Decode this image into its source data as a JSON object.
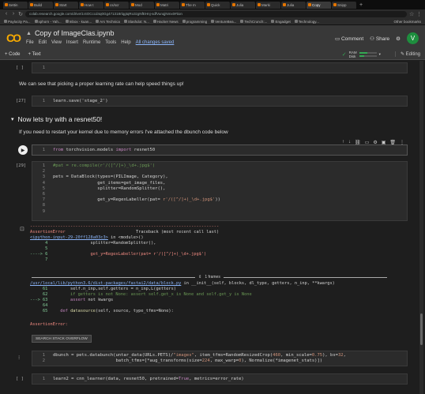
{
  "browser": {
    "tabs": [
      "Settin",
      "Build",
      "Start",
      "How t",
      "cs/scr",
      "Mod",
      "Matri",
      "The m",
      "Quick",
      "Julia",
      "Marki",
      "Julia",
      "Copy",
      "Snipp"
    ],
    "url": "colab.research.google.com/drive/1r4OCccd4q0Gg471318rlqgtqRo3zgNfEHnj-sdfVunqjNmx0#tion",
    "bookmarks": [
      "Paylocity Pa...",
      "xphorn - Yah...",
      "Inbox - kuan...",
      "Ars Technica",
      "Slashdot: N...",
      "Hacker News",
      "programming",
      "VentureBea...",
      "TechCrunch:...",
      "Engadget",
      "Technology..."
    ],
    "other_bookmarks": "Other bookmarks"
  },
  "header": {
    "logo": "CO",
    "title": "Copy of ImageClas.ipynb",
    "menu": [
      "File",
      "Edit",
      "View",
      "Insert",
      "Runtime",
      "Tools",
      "Help"
    ],
    "saved": "All changes saved",
    "comment": "Comment",
    "share": "Share",
    "avatar": "V"
  },
  "toolbar": {
    "code": "+ Code",
    "text": "+ Text",
    "ram": "RAM",
    "disk": "Disk",
    "ram_fraction": 0.45,
    "disk_fraction": 0.3,
    "editing": "Editing"
  },
  "cells": {
    "c1_prompt": "[ ]",
    "c1_ln": "1",
    "md1": "We can see that picking a proper learning rate can help speed things up!",
    "c2_prompt": "[27]",
    "c2_ln": "1",
    "c2_code": "learn.save('stage_2')",
    "heading": "Now lets try with a resnet50!",
    "md2": "If you need to restart your kernel due to memory errors I've attached the dbunch code below",
    "c3_ln": "1",
    "c4_prompt": "[29]",
    "c6_prompt": "[ ]",
    "c6_ln": "1"
  },
  "traceback": {
    "dashes": "---------------------------------------------------------------------------",
    "err": "AssertionError",
    "tb_head": "Traceback (most recent call last)",
    "link1": "<ipython-input-29-20ff128a03c3>",
    "in_module": " in <module>()",
    "frames_label": "1 frames",
    "link2": "/usr/local/lib/python3.6/dist-packages/fastai2/data/block.py",
    "init_sig": " in __init__(self, blocks, dl_type, getters, n_inp, **kwargs)",
    "final_err": "AssertionError:",
    "stack_btn": "SEARCH STACK OVERFLOW"
  }
}
